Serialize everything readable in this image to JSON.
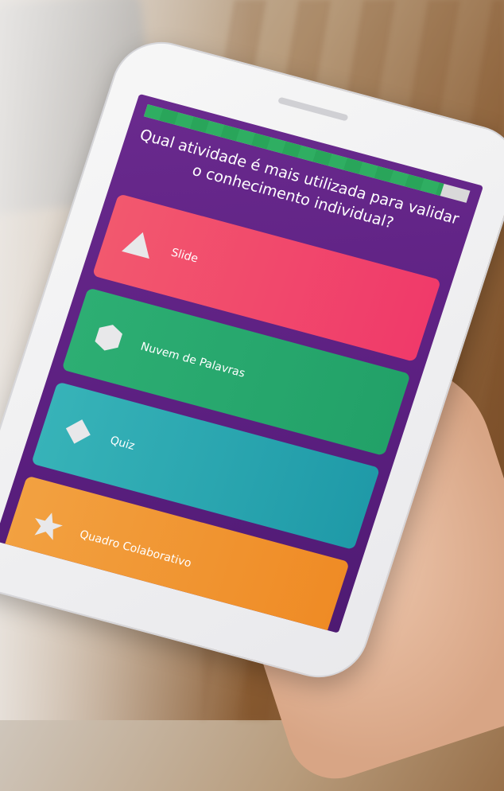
{
  "quiz": {
    "question": "Qual atividade é mais utilizada para validar o conhecimento individual?",
    "progress": 0.92,
    "options": [
      {
        "label": "Slide",
        "icon": "triangle-icon",
        "color": "#f03a6a"
      },
      {
        "label": "Nuvem de Palavras",
        "icon": "hexagon-icon",
        "color": "#22a168"
      },
      {
        "label": "Quiz",
        "icon": "diamond-icon",
        "color": "#1f9aa8"
      },
      {
        "label": "Quadro Colaborativo",
        "icon": "star-icon",
        "color": "#ef8b25"
      }
    ]
  },
  "colors": {
    "screen_background": "#5b1f80",
    "progress_fill": "#2fae62",
    "progress_track": "#d9d9d9"
  }
}
